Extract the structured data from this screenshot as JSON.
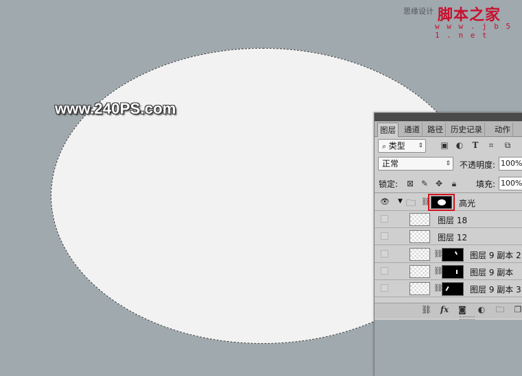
{
  "watermarks": {
    "site": "www.240PS.com",
    "jb51_prefix": "思缘设计",
    "jb51_brand": "脚本之家",
    "jb51_url": "w w w . j b 5 1 . n e t"
  },
  "panel": {
    "tabs": [
      "图层",
      "通道",
      "路径",
      "历史记录",
      "动作"
    ],
    "filter_kind": "类型",
    "blend_mode": "正常",
    "opacity_label": "不透明度:",
    "opacity_value": "100%",
    "lock_label": "锁定:",
    "fill_label": "填充:",
    "fill_value": "100%",
    "layers": [
      {
        "name": "高光",
        "type": "group",
        "visible": true
      },
      {
        "name": "图层 18",
        "type": "layer",
        "visible": false
      },
      {
        "name": "图层 12",
        "type": "layer",
        "visible": false
      },
      {
        "name": "图层 9 副本 2",
        "type": "layer-mask",
        "visible": false
      },
      {
        "name": "图层 9 副本",
        "type": "layer-mask",
        "visible": false
      },
      {
        "name": "图层 9 副本 3",
        "type": "layer-mask",
        "visible": false
      }
    ],
    "bottom_icons": [
      "link-icon",
      "fx-icon",
      "add-mask-icon",
      "adjustment-icon",
      "new-group-icon",
      "new-layer-icon"
    ]
  },
  "colors": {
    "canvas_bg": "#9fa9ae",
    "selection_fill": "#f2f2f3",
    "highlight_box": "#d4101a"
  }
}
